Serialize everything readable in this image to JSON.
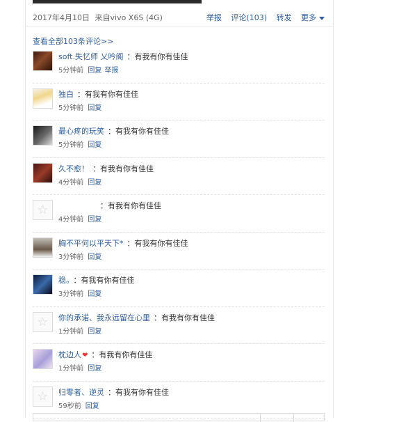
{
  "post_meta": {
    "date": "2017年4月10日",
    "source": "来自vivo X6S (4G)",
    "report": "举报",
    "comments": "评论(103)",
    "repost": "转发",
    "more": "更多"
  },
  "view_all": "查看全部103条评论>>",
  "comments": [
    {
      "name": "soft.失忆师 乂吟阁",
      "text": "有我有你有佳佳",
      "time": "5分钟前",
      "reply": "回复",
      "report": "举报"
    },
    {
      "name": "独白",
      "text": "有我有你有佳佳",
      "time": "5分钟前",
      "reply": "回复"
    },
    {
      "name": "最心疼的玩笑",
      "text": "有我有你有佳佳",
      "time": "5分钟前",
      "reply": "回复"
    },
    {
      "name": "久不愈！",
      "text": "有我有你有佳佳",
      "time": "4分钟前",
      "reply": "回复"
    },
    {
      "name": "",
      "text": "有我有你有佳佳",
      "time": "4分钟前",
      "reply": "回复"
    },
    {
      "name": "胸不平何以平天下*",
      "text": "有我有你有佳佳",
      "time": "3分钟前",
      "reply": "回复"
    },
    {
      "name": "稳。",
      "text": "有我有你有佳佳",
      "time": "3分钟前",
      "reply": "回复"
    },
    {
      "name": "你的承诺、我永远留在心里",
      "text": "有我有你有佳佳",
      "time": "1分钟前",
      "reply": "回复"
    },
    {
      "name": "枕边人",
      "text": "有我有你有佳佳",
      "time": "1分钟前",
      "reply": "回复"
    },
    {
      "name": "归零者、逆灵",
      "text": "有我有你有佳佳",
      "time": "59秒前",
      "reply": "回复"
    }
  ],
  "colors": {
    "link": "#2e5e9e",
    "text": "#333333",
    "muted": "#666666"
  },
  "icons": {
    "default_avatar": "star-icon",
    "more": "caret-down-icon",
    "emoji": "heart-icon"
  }
}
